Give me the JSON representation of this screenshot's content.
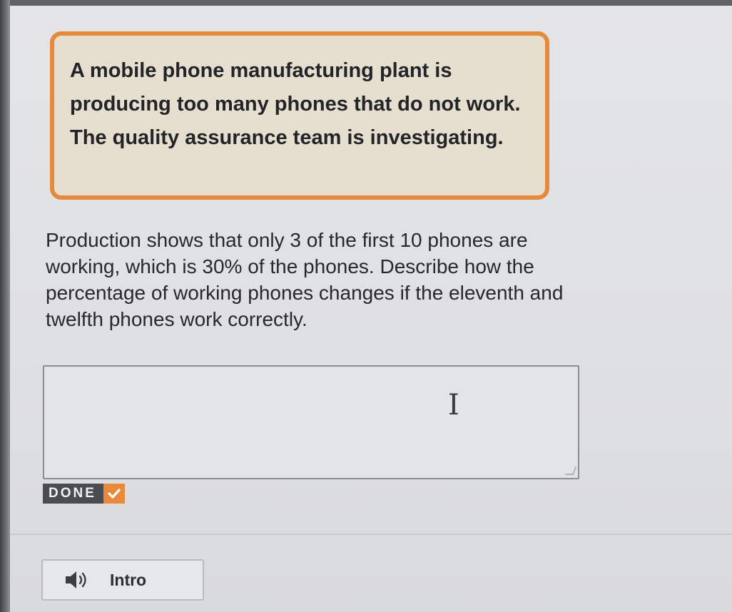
{
  "scenario": {
    "text": "A mobile phone manufacturing plant is producing too many phones that do not work. The quality assurance team is investigating."
  },
  "question": {
    "text": "Production shows that only 3 of the first 10 phones are working, which is 30% of the phones. Describe how the percentage of working phones changes if the eleventh and twelfth phones work correctly."
  },
  "answer": {
    "value": ""
  },
  "done_button": {
    "label": "DONE"
  },
  "intro_button": {
    "label": "Intro"
  },
  "colors": {
    "accent": "#e48a3a",
    "scenario_background": "#e6dfcf",
    "done_background": "#4a4c50"
  },
  "icons": {
    "done": "checkmark-icon",
    "audio": "speaker-icon",
    "cursor": "text-cursor-icon"
  }
}
